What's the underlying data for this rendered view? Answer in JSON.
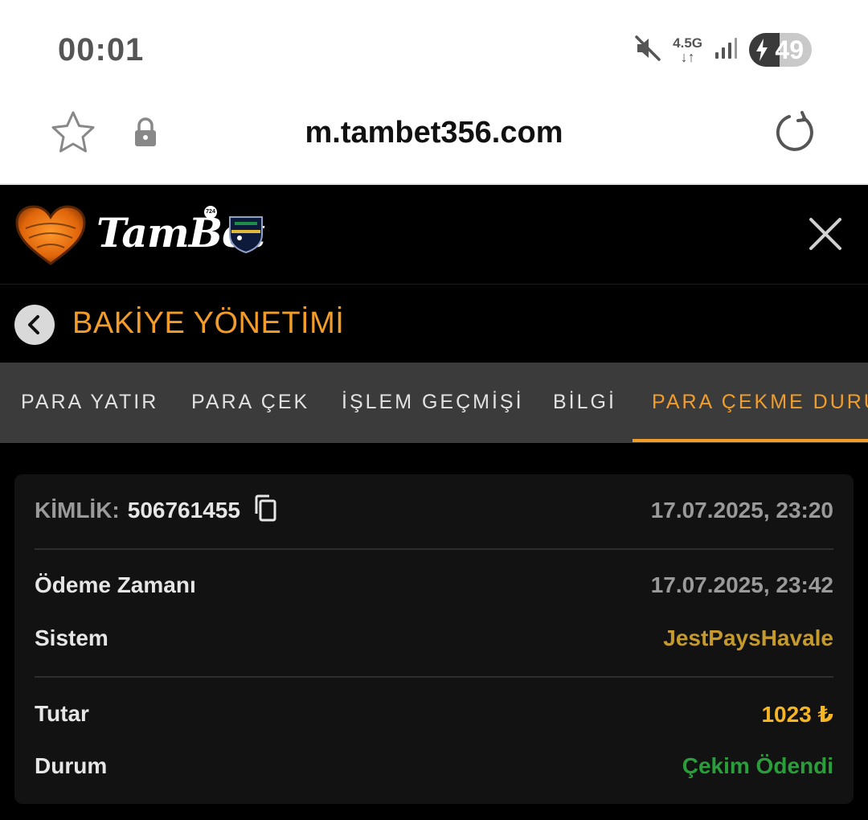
{
  "status_bar": {
    "time": "00:01",
    "network_label": "4.5G",
    "network_arrows": "↓↑",
    "battery_level": "49",
    "battery_percent": 49,
    "icons": [
      "mute-icon",
      "signal-icon",
      "battery-charging-icon"
    ]
  },
  "browser": {
    "url": "m.tambet356.com",
    "icons": [
      "star-icon",
      "lock-icon",
      "reload-icon"
    ]
  },
  "app_header": {
    "brand_name": "TamBet",
    "badge": "724",
    "icons": [
      "heart-logo-icon",
      "sponsor-shield-icon",
      "close-icon"
    ]
  },
  "section": {
    "title": "BAKİYE YÖNETİMİ",
    "back_icon": "chevron-left-icon"
  },
  "tabs": [
    {
      "label": "PARA YATIR",
      "active": false
    },
    {
      "label": "PARA ÇEK",
      "active": false
    },
    {
      "label": "İŞLEM GEÇMİŞİ",
      "active": false
    },
    {
      "label": "BİLGİ",
      "active": false
    },
    {
      "label": "PARA ÇEKME DURUMU",
      "active": true
    }
  ],
  "transaction": {
    "id_label": "KİMLİK:",
    "id_value": "506761455",
    "created_at": "17.07.2025, 23:20",
    "payment_time_label": "Ödeme Zamanı",
    "payment_time_value": "17.07.2025, 23:42",
    "system_label": "Sistem",
    "system_value": "JestPaysHavale",
    "amount_label": "Tutar",
    "amount_value": "1023 ₺",
    "status_label": "Durum",
    "status_value": "Çekim Ödendi"
  },
  "colors": {
    "accent": "#f29d2a",
    "system_value": "#c49a2c",
    "amount": "#f7b521",
    "status_paid": "#2a9e3a",
    "tab_bar": "#3b3b3b",
    "card": "#121212"
  }
}
